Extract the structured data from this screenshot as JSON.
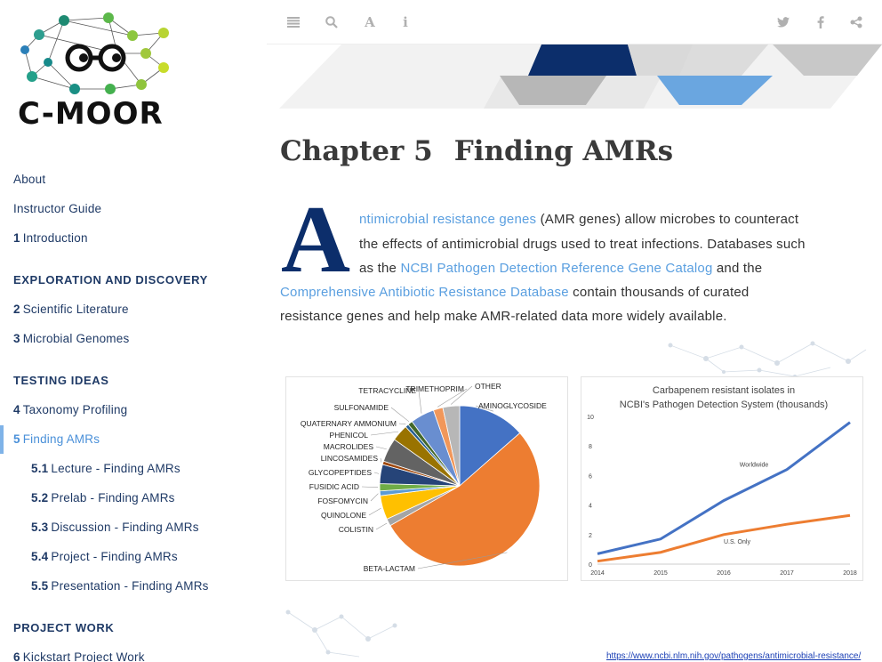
{
  "sidebar": {
    "logo_text": "C-MOOR",
    "items": [
      {
        "num": "",
        "label": "About"
      },
      {
        "num": "",
        "label": "Instructor Guide"
      },
      {
        "num": "1",
        "label": "Introduction"
      },
      {
        "section": "EXPLORATION AND DISCOVERY"
      },
      {
        "num": "2",
        "label": "Scientific Literature"
      },
      {
        "num": "3",
        "label": "Microbial Genomes"
      },
      {
        "section": "TESTING IDEAS"
      },
      {
        "num": "4",
        "label": "Taxonomy Profiling"
      },
      {
        "num": "5",
        "label": "Finding AMRs"
      },
      {
        "num": "5.1",
        "label": "Lecture - Finding AMRs"
      },
      {
        "num": "5.2",
        "label": "Prelab - Finding AMRs"
      },
      {
        "num": "5.3",
        "label": "Discussion - Finding AMRs"
      },
      {
        "num": "5.4",
        "label": "Project - Finding AMRs"
      },
      {
        "num": "5.5",
        "label": "Presentation - Finding AMRs"
      },
      {
        "section": "PROJECT WORK"
      },
      {
        "num": "6",
        "label": "Kickstart Project Work"
      }
    ]
  },
  "toolbar": {
    "menu_icon": "menu-icon",
    "search_icon": "search-icon",
    "font_icon": "font-icon",
    "info_icon": "info-icon",
    "twitter_icon": "twitter-icon",
    "facebook_icon": "facebook-icon",
    "share_icon": "share-icon"
  },
  "main": {
    "chapter_number": "Chapter 5",
    "chapter_title": "Finding AMRs",
    "dropcap": "A",
    "para": {
      "l1_link": "ntimicrobial resistance genes",
      "l1_rest": " (AMR genes) allow microbes to counteract",
      "l2": "the effects of antimicrobial drugs used to treat infections. Databases such",
      "l3_pre": "as the ",
      "l3_link": "NCBI Pathogen Detection Reference Gene Catalog",
      "l3_post": " and the",
      "l4_link": "Comprehensive Antibiotic Resistance Database",
      "l4_post": " contain thousands of curated",
      "l5": "resistance genes and help make AMR-related data more widely available."
    },
    "source_link": "https://www.ncbi.nlm.nih.gov/pathogens/antimicrobial-resistance/"
  },
  "chart_data": [
    {
      "type": "pie",
      "categories": [
        "AMINOGLYCOSIDE",
        "BETA-LACTAM",
        "COLISTIN",
        "QUINOLONE",
        "FOSFOMYCIN",
        "FUSIDIC ACID",
        "GLYCOPEPTIDES",
        "LINCOSAMIDES",
        "MACROLIDES",
        "PHENICOL",
        "QUATERNARY AMMONIUM",
        "SULFONAMIDE",
        "TETRACYCLINE",
        "TRIMETHOPRIM",
        "OTHER"
      ],
      "values": [
        14,
        55,
        1.5,
        5,
        1,
        1.5,
        4,
        0.7,
        5,
        3.5,
        0.7,
        1,
        5,
        2,
        3.5
      ],
      "colors": [
        "#4472c4",
        "#ed7d31",
        "#a5a5a5",
        "#ffc000",
        "#5b9bd5",
        "#70ad47",
        "#264478",
        "#9e480e",
        "#636363",
        "#997300",
        "#255e91",
        "#43682b",
        "#698ed0",
        "#f1975a",
        "#b7b7b7"
      ]
    },
    {
      "type": "line",
      "title": "Carbapenem resistant isolates in",
      "subtitle": "NCBI's Pathogen Detection System (thousands)",
      "x": [
        2014,
        2015,
        2016,
        2017,
        2018
      ],
      "ylim": [
        0,
        10
      ],
      "yticks": [
        0,
        2,
        4,
        6,
        8,
        10
      ],
      "series": [
        {
          "name": "Worldwide",
          "values": [
            0.7,
            1.7,
            4.3,
            6.4,
            9.6
          ],
          "color": "#4472c4"
        },
        {
          "name": "U.S. Only",
          "values": [
            0.2,
            0.8,
            2.0,
            2.7,
            3.3
          ],
          "color": "#ed7d31"
        }
      ]
    }
  ]
}
